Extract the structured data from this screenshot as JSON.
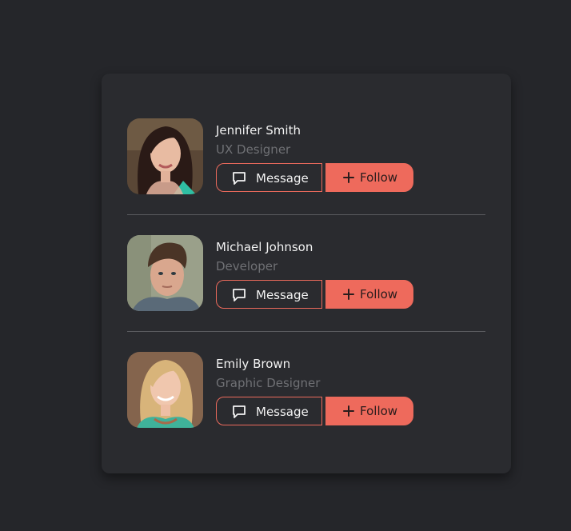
{
  "people": [
    {
      "name": "Jennifer Smith",
      "role": "UX Designer",
      "message_label": "Message",
      "follow_label": "Follow"
    },
    {
      "name": "Michael Johnson",
      "role": "Developer",
      "message_label": "Message",
      "follow_label": "Follow"
    },
    {
      "name": "Emily Brown",
      "role": "Graphic Designer",
      "message_label": "Message",
      "follow_label": "Follow"
    }
  ],
  "icons": {
    "message": "chat-bubble-icon",
    "follow": "plus-icon"
  },
  "colors": {
    "accent": "#ee6a5c",
    "background": "#25262a",
    "card": "#2a2b2f",
    "name_text": "#f2f2f2",
    "role_text": "#6f7074"
  }
}
